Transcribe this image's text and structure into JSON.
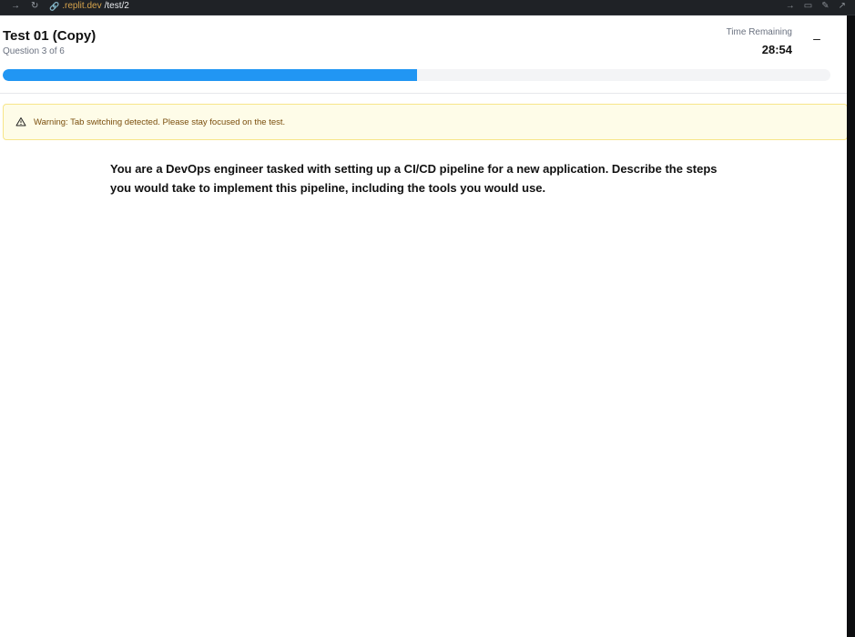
{
  "browser": {
    "url_domain": ".replit.dev",
    "url_path": "/test/2"
  },
  "header": {
    "title": "Test 01 (Copy)",
    "subtitle": "Question 3 of 6",
    "timer_label": "Time Remaining",
    "timer_value": "28:54",
    "minimize_glyph": "–"
  },
  "progress": {
    "fraction": 0.5,
    "color": "#2196f3"
  },
  "warning": {
    "icon": "alert-triangle-icon",
    "text": "Warning: Tab switching detected. Please stay focused on the test."
  },
  "question": {
    "text": "You are a DevOps engineer tasked with setting up a CI/CD pipeline for a new application. Describe the steps you would take to implement this pipeline, including the tools you would use."
  }
}
